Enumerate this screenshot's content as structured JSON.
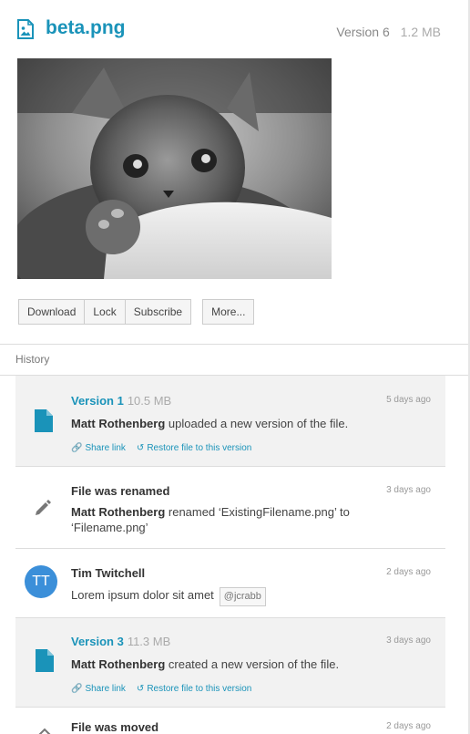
{
  "header": {
    "icon": "image-file-icon",
    "file_name": "beta.png",
    "version": "Version 6",
    "size": "1.2 MB"
  },
  "toolbar": {
    "download": "Download",
    "lock": "Lock",
    "subscribe": "Subscribe",
    "more": "More..."
  },
  "history": {
    "label": "History",
    "items": [
      {
        "type": "version",
        "title": "Version 1",
        "size": "10.5 MB",
        "time": "5 days ago",
        "user": "Matt Rothenberg",
        "text": " uploaded a new version of the file.",
        "share": "Share link",
        "restore": "Restore file to this version"
      },
      {
        "type": "rename",
        "title": "File was renamed",
        "time": "3 days ago",
        "user": "Matt Rothenberg",
        "text": " renamed ‘ExistingFilename.png’ to ‘Filename.png’"
      },
      {
        "type": "comment",
        "initials": "TT",
        "title": "Tim Twitchell",
        "time": "2 days ago",
        "text": "Lorem ipsum dolor sit amet",
        "tag": "@jcrabb"
      },
      {
        "type": "version",
        "title": "Version 3",
        "size": "11.3 MB",
        "time": "3 days ago",
        "user": "Matt Rothenberg",
        "text": " created a new version of the file.",
        "share": "Share link",
        "restore": "Restore file to this version"
      },
      {
        "type": "move",
        "title": "File was moved",
        "time": "2 days ago"
      }
    ]
  },
  "colors": {
    "accent": "#1a93b9",
    "avatar": "#3b8fd9"
  }
}
